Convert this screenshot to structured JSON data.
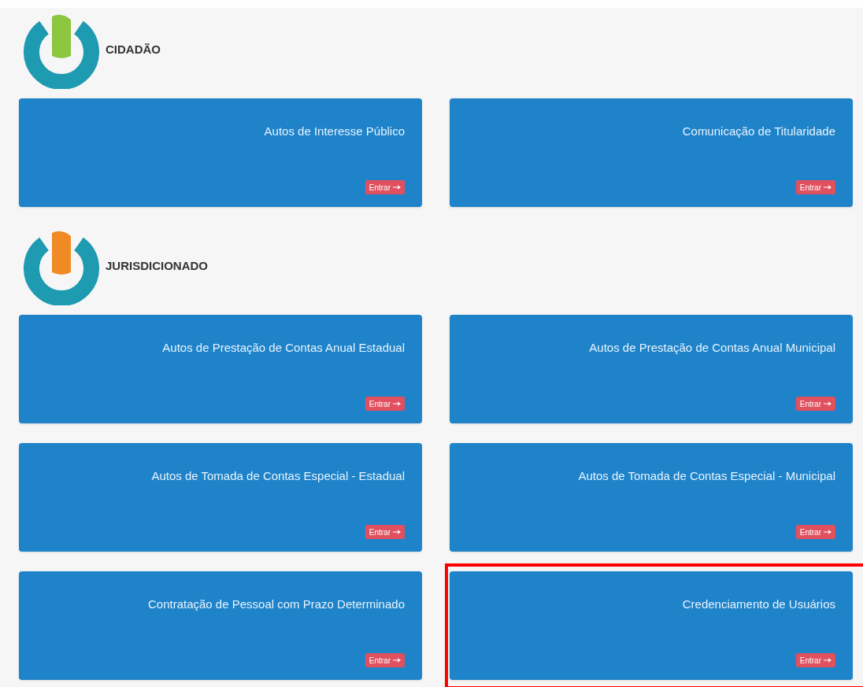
{
  "sections": [
    {
      "title": "CIDADÃO",
      "color": "#8cc63f",
      "cards": [
        {
          "title": "Autos de Interesse Público",
          "button": "Entrar",
          "highlighted": false
        },
        {
          "title": "Comunicação de Titularidade",
          "button": "Entrar",
          "highlighted": false
        }
      ]
    },
    {
      "title": "JURISDICIONADO",
      "color": "#f08a24",
      "cards": [
        {
          "title": "Autos de Prestação de Contas Anual Estadual",
          "button": "Entrar",
          "highlighted": false
        },
        {
          "title": "Autos de Prestação de Contas Anual Municipal",
          "button": "Entrar",
          "highlighted": false
        },
        {
          "title": "Autos de Tomada de Contas Especial - Estadual",
          "button": "Entrar",
          "highlighted": false
        },
        {
          "title": "Autos de Tomada de Contas Especial - Municipal",
          "button": "Entrar",
          "highlighted": false
        },
        {
          "title": "Contratação de Pessoal com Prazo Determinado",
          "button": "Entrar",
          "highlighted": false
        },
        {
          "title": "Credenciamento de Usuários",
          "button": "Entrar",
          "highlighted": true
        }
      ]
    }
  ]
}
